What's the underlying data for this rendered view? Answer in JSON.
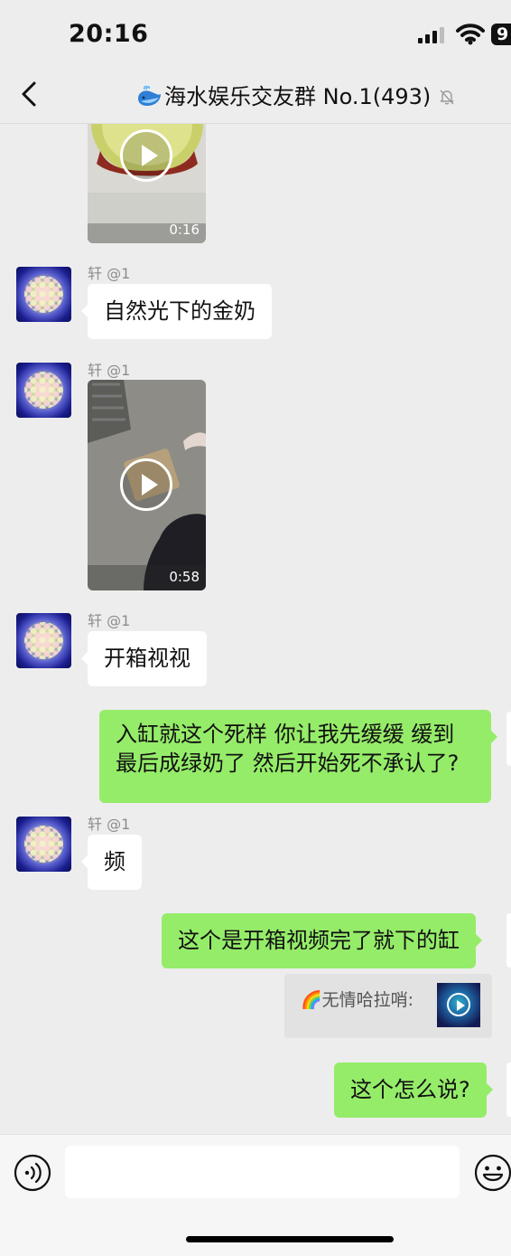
{
  "status": {
    "time": "20:16",
    "battery": "9"
  },
  "header": {
    "title": "海水娱乐交友群 No.1(493)"
  },
  "messages": [
    {
      "duration": "0:16"
    },
    {
      "sender": "轩 @1",
      "text": "自然光下的金奶"
    },
    {
      "sender": "轩 @1",
      "duration": "0:58"
    },
    {
      "sender": "轩 @1",
      "text": "开箱视视"
    },
    {
      "line1": "入缸就这个死样 你让我先缓缓 缓到",
      "line2": "最后成绿奶了 然后开始死不承认了?"
    },
    {
      "sender": "轩 @1",
      "text": "频"
    },
    {
      "text": "这个是开箱视频完了就下的缸"
    },
    {
      "quote": "🌈无情哈拉哨:"
    },
    {
      "text": "这个怎么说?"
    }
  ],
  "icons": {
    "back": "chevron-left-icon",
    "title_emoji": "whale-icon",
    "mute": "bell-muted-icon",
    "voice": "voice-icon",
    "emoji": "smiley-icon",
    "play": "play-icon"
  },
  "colors": {
    "sent_bubble": "#95ec69",
    "received_bubble": "#ffffff",
    "background": "#ededed"
  }
}
